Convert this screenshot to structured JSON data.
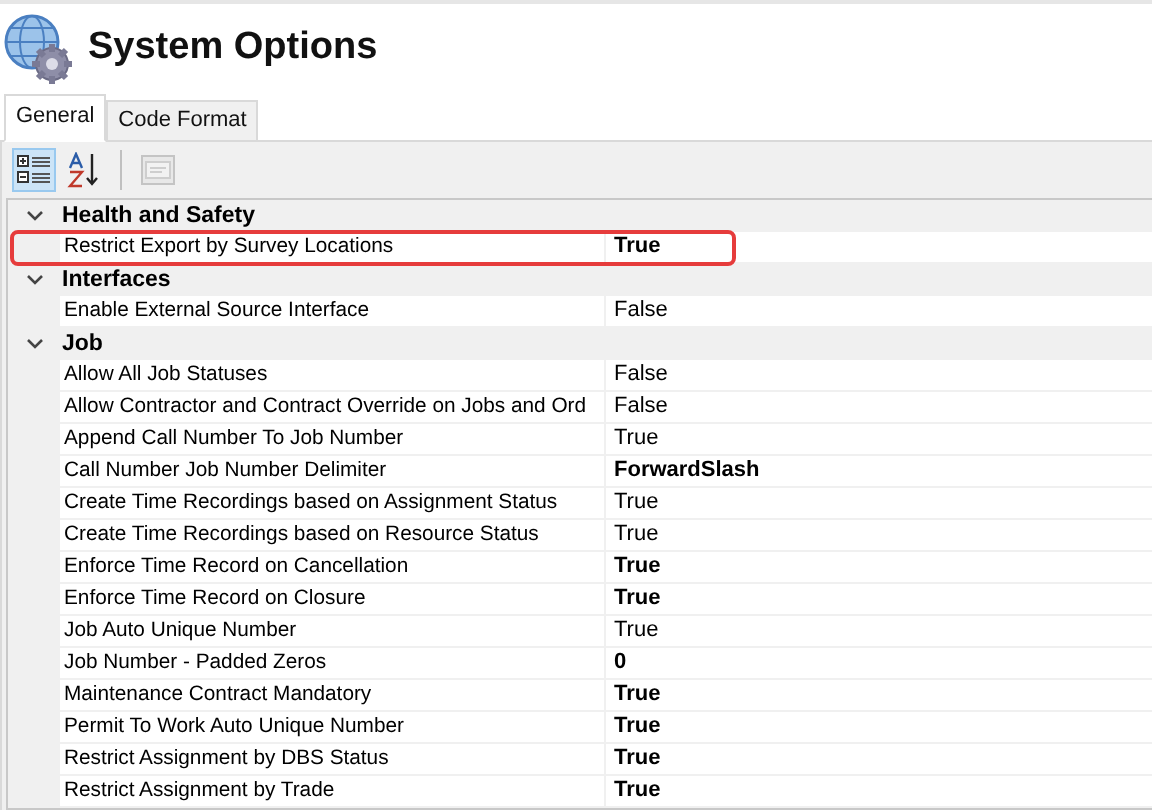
{
  "window": {
    "title": "System Options"
  },
  "tabs": [
    {
      "label": "General",
      "selected": true
    },
    {
      "label": "Code Format",
      "selected": false
    }
  ],
  "toolbar": [
    {
      "kind": "categorized",
      "selected": true,
      "disabled": false
    },
    {
      "kind": "alphabetical",
      "selected": false,
      "disabled": false
    },
    {
      "kind": "property-pages",
      "selected": false,
      "disabled": true
    }
  ],
  "categories": [
    {
      "name": "Health and Safety",
      "expanded": true,
      "properties": [
        {
          "name": "Restrict Export by Survey Locations",
          "value": "True",
          "modified": true,
          "highlighted": true
        }
      ]
    },
    {
      "name": "Interfaces",
      "expanded": true,
      "properties": [
        {
          "name": "Enable External Source Interface",
          "value": "False",
          "modified": false,
          "highlighted": false
        }
      ]
    },
    {
      "name": "Job",
      "expanded": true,
      "properties": [
        {
          "name": "Allow All Job Statuses",
          "value": "False",
          "modified": false,
          "highlighted": false
        },
        {
          "name": "Allow Contractor and Contract Override on Jobs and Ord",
          "value": "False",
          "modified": false,
          "highlighted": false
        },
        {
          "name": "Append Call Number To Job Number",
          "value": "True",
          "modified": false,
          "highlighted": false
        },
        {
          "name": "Call Number Job Number Delimiter",
          "value": "ForwardSlash",
          "modified": true,
          "highlighted": false
        },
        {
          "name": "Create Time Recordings based on Assignment Status",
          "value": "True",
          "modified": false,
          "highlighted": false
        },
        {
          "name": "Create Time Recordings based on Resource Status",
          "value": "True",
          "modified": false,
          "highlighted": false
        },
        {
          "name": "Enforce Time Record on Cancellation",
          "value": "True",
          "modified": true,
          "highlighted": false
        },
        {
          "name": "Enforce Time Record on Closure",
          "value": "True",
          "modified": true,
          "highlighted": false
        },
        {
          "name": "Job Auto Unique Number",
          "value": "True",
          "modified": false,
          "highlighted": false
        },
        {
          "name": "Job Number - Padded Zeros",
          "value": "0",
          "modified": true,
          "highlighted": false
        },
        {
          "name": "Maintenance Contract Mandatory",
          "value": "True",
          "modified": true,
          "highlighted": false
        },
        {
          "name": "Permit To Work Auto Unique Number",
          "value": "True",
          "modified": true,
          "highlighted": false
        },
        {
          "name": "Restrict Assignment by DBS Status",
          "value": "True",
          "modified": true,
          "highlighted": false
        },
        {
          "name": "Restrict Assignment by Trade",
          "value": "True",
          "modified": true,
          "highlighted": false
        }
      ]
    }
  ]
}
